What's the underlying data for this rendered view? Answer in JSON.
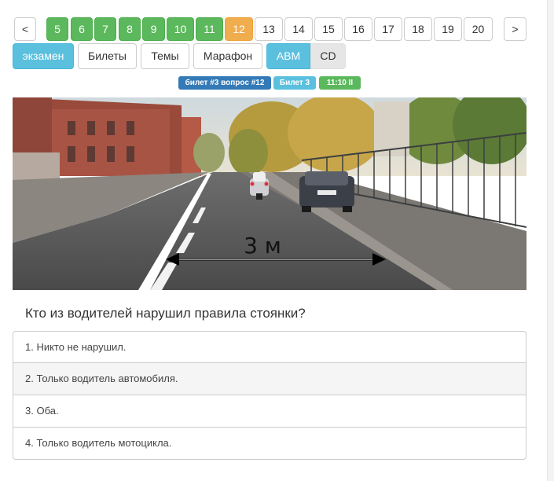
{
  "pagination": {
    "prev": "<",
    "next": ">",
    "pages": [
      {
        "label": "5",
        "state": "done"
      },
      {
        "label": "6",
        "state": "done"
      },
      {
        "label": "7",
        "state": "done"
      },
      {
        "label": "8",
        "state": "done"
      },
      {
        "label": "9",
        "state": "done"
      },
      {
        "label": "10",
        "state": "done"
      },
      {
        "label": "11",
        "state": "done"
      },
      {
        "label": "12",
        "state": "current"
      },
      {
        "label": "13",
        "state": "todo"
      },
      {
        "label": "14",
        "state": "todo"
      },
      {
        "label": "15",
        "state": "todo"
      },
      {
        "label": "16",
        "state": "todo"
      },
      {
        "label": "17",
        "state": "todo"
      },
      {
        "label": "18",
        "state": "todo"
      },
      {
        "label": "19",
        "state": "todo"
      },
      {
        "label": "20",
        "state": "todo"
      }
    ]
  },
  "modes": {
    "exam": "экзамен",
    "tickets": "Билеты",
    "topics": "Темы",
    "marathon": "Марафон",
    "abm": "ABM",
    "cd": "CD"
  },
  "badges": {
    "question_ref": "билет #3 вопрос #12",
    "ticket": "Билет 3",
    "timer": "11:10 II"
  },
  "image": {
    "distance_label": "3 м"
  },
  "question": "Кто из водителей нарушил правила стоянки?",
  "answers": [
    "1. Никто не нарушил.",
    "2. Только водитель автомобиля.",
    "3. Оба.",
    "4. Только водитель мотоцикла."
  ],
  "colors": {
    "done": "#5cb85c",
    "current": "#f0ad4e",
    "active": "#5bc0de",
    "primary": "#337ab7"
  }
}
